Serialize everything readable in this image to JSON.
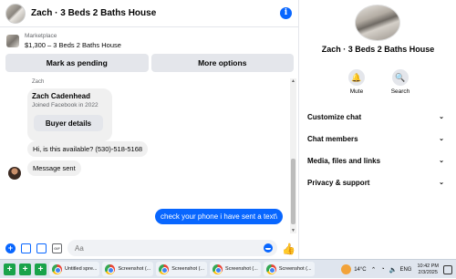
{
  "header": {
    "title": "Zach · 3 Beds 2 Baths House",
    "info_icon": "i"
  },
  "marketplace": {
    "label": "Marketplace",
    "listing": "$1,300 – 3 Beds 2 Baths House",
    "buttons": {
      "mark_pending": "Mark as pending",
      "more_options": "More options"
    }
  },
  "messages": {
    "sender_label": "Zach",
    "card": {
      "name": "Zach Cadenhead",
      "subtitle": "Joined Facebook in 2022",
      "button": "Buyer details"
    },
    "incoming": [
      "Hi, is this available? (530)-518-5168",
      "Message sent"
    ],
    "outgoing": [
      "check your phone i have sent a text\\"
    ]
  },
  "composer": {
    "placeholder": "Aa",
    "plus": "+",
    "gif": "GIF"
  },
  "right_panel": {
    "title": "Zach · 3 Beds 2 Baths House",
    "actions": [
      {
        "label": "Mute",
        "icon": "bell-icon"
      },
      {
        "label": "Search",
        "icon": "search-icon"
      }
    ],
    "sections": [
      "Customize chat",
      "Chat members",
      "Media, files and links",
      "Privacy & support"
    ]
  },
  "taskbar": {
    "apps": [
      "Untitled spre...",
      "Screenshot (...",
      "Screenshot (...",
      "Screenshot (...",
      "Screenshot (..."
    ],
    "temperature": "14°C",
    "language": "ENG",
    "time": "10:42 PM",
    "date": "2/3/2025"
  },
  "colors": {
    "accent": "#0866ff",
    "bubble_in": "#f0f0f0",
    "button_bg": "#e4e6eb"
  }
}
